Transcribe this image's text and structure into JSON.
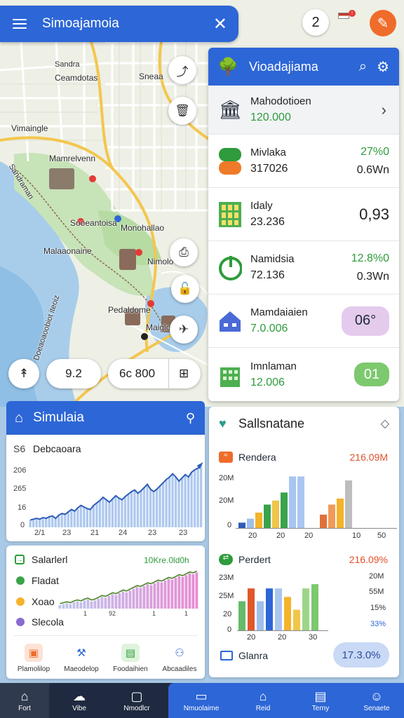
{
  "topbar": {
    "title": "Simoajamoia",
    "menu_icon": "hamburger-icon",
    "close_icon": "close-icon"
  },
  "header_badges": {
    "count": "2",
    "flag_badge": "!"
  },
  "map": {
    "labels": [
      "Sandra",
      "Ceamdotas",
      "Sneaa",
      "Vimaingle",
      "Mamrelvenn",
      "Sandraman",
      "Sooeantoisa",
      "Monohallao",
      "Malaaonaine",
      "Nimolo",
      "Pedaldome",
      "Maigloso"
    ],
    "side_text": "Doeaoaoobiot iteoiz"
  },
  "map_controls": {
    "value1": "9.2",
    "value2": "6c 800"
  },
  "panel": {
    "title": "Vioadajiama",
    "rows": [
      {
        "name": "Mahodotioen",
        "value": "120.000"
      },
      {
        "name": "Mivlaka",
        "value": "317026",
        "right_a": "27%0",
        "right_b": "0.6Wn"
      },
      {
        "name": "Idaly",
        "value": "23.236",
        "right_big": "0,93"
      },
      {
        "name": "Namidsia",
        "value": "72.136",
        "right_a": "12.8%0",
        "right_b": "0.3Wn"
      },
      {
        "name": "Mamdaiaien",
        "value": "7.0.006",
        "pill": "06°"
      },
      {
        "name": "Imnlaman",
        "value": "12.006",
        "pill": "01"
      }
    ]
  },
  "simcard": {
    "title": "Simulaia",
    "chart1": {
      "corner": "S6",
      "label": "Debcaoara",
      "yticks": [
        "206",
        "265",
        "16",
        "0"
      ],
      "xticks": [
        "2/1",
        "23",
        "21",
        "24",
        "23",
        "23"
      ]
    },
    "chart2": {
      "title": "Salarlerl",
      "right_label": "10Kre.0ld0h",
      "legend": [
        "Fladat",
        "Xoao",
        "Slecola"
      ],
      "xticks": [
        "1",
        "92",
        "1",
        "1"
      ]
    },
    "nav": [
      "Plamolilop",
      "Maeodelop",
      "Foodaihien",
      "Abcaadiles"
    ]
  },
  "statcard": {
    "title": "Sallsnatane",
    "chart1": {
      "label": "Rendera",
      "value": "216.09M",
      "yticks": [
        "20M",
        "20M",
        "0"
      ],
      "xticks": [
        "20",
        "20",
        "20",
        "10",
        "50"
      ]
    },
    "chart2": {
      "label": "Perdert",
      "value": "216.09%",
      "yticks": [
        "23M",
        "25M",
        "20",
        "0"
      ],
      "right_ticks": [
        "20M",
        "55M",
        "15%",
        "33%"
      ],
      "xticks": [
        "20",
        "20",
        "30"
      ]
    },
    "footer_label": "Glanra",
    "footer_value": "17.3.0%"
  },
  "chart_data": [
    {
      "type": "bar",
      "title": "Debcaoara",
      "values": [
        9,
        10,
        11,
        10,
        12,
        11,
        13,
        14,
        11,
        15,
        17,
        16,
        19,
        22,
        20,
        24,
        27,
        25,
        23,
        22,
        27,
        30,
        33,
        37,
        34,
        31,
        35,
        39,
        36,
        34,
        38,
        41,
        44,
        46,
        42,
        45,
        49,
        53,
        47,
        44,
        47,
        51,
        55,
        59,
        62,
        66,
        62,
        57,
        61,
        65,
        62,
        68,
        71,
        73,
        77
      ],
      "ylim": [
        0,
        90
      ]
    },
    {
      "type": "bar",
      "title": "Salarlerl",
      "values": [
        4,
        5,
        6,
        5,
        7,
        8,
        7,
        9,
        10,
        8,
        9,
        11,
        13,
        12,
        14,
        16,
        15,
        17,
        19,
        18,
        20,
        22,
        24,
        23,
        25,
        27,
        26,
        28,
        30,
        29,
        31,
        33,
        32,
        34,
        36,
        35,
        37,
        39,
        38,
        40
      ],
      "ylim": [
        0,
        45
      ]
    },
    {
      "type": "bar",
      "title": "Rendera",
      "categories": [
        "1",
        "2",
        "3",
        "4",
        "5",
        "6",
        "7",
        "8",
        "9",
        "10",
        "11",
        "12",
        "13",
        "14"
      ],
      "values": [
        3,
        5,
        8,
        12,
        14,
        18,
        26,
        26,
        0,
        0,
        7,
        12,
        15,
        24
      ],
      "ylim": [
        0,
        30
      ]
    },
    {
      "type": "bar",
      "title": "Perdert",
      "categories": [
        "1",
        "2",
        "3",
        "4",
        "5",
        "6",
        "7",
        "8",
        "9"
      ],
      "values": [
        14,
        20,
        14,
        20,
        20,
        16,
        10,
        20,
        22
      ],
      "ylim": [
        0,
        25
      ]
    }
  ]
}
